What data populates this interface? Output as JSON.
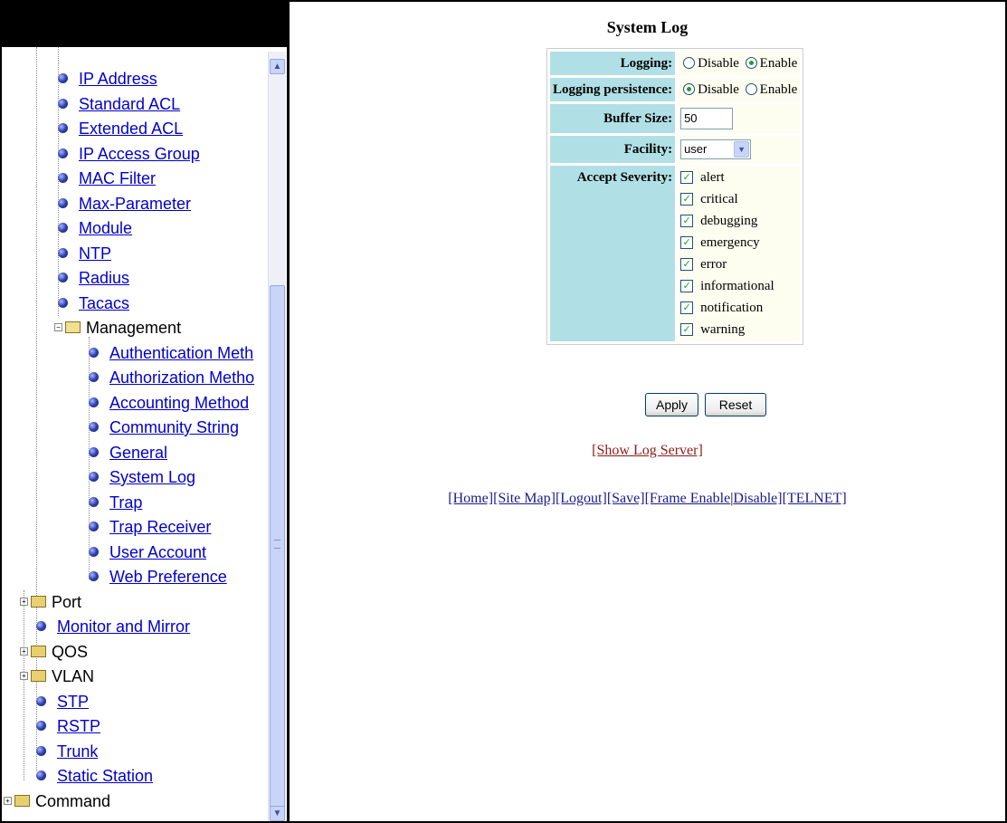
{
  "nav": {
    "items": [
      {
        "label": "IP Address",
        "link": true
      },
      {
        "label": "Standard ACL",
        "link": true
      },
      {
        "label": "Extended ACL",
        "link": true
      },
      {
        "label": "IP Access Group",
        "link": true
      },
      {
        "label": "MAC Filter",
        "link": true
      },
      {
        "label": "Max-Parameter",
        "link": true
      },
      {
        "label": "Module",
        "link": true
      },
      {
        "label": "NTP",
        "link": true
      },
      {
        "label": "Radius",
        "link": true
      },
      {
        "label": "Tacacs",
        "link": true
      },
      {
        "label": "Management",
        "link": false,
        "folder": "expanded"
      },
      {
        "label": "Authentication Meth",
        "link": true
      },
      {
        "label": "Authorization Metho",
        "link": true
      },
      {
        "label": "Accounting Method",
        "link": true
      },
      {
        "label": "Community String",
        "link": true
      },
      {
        "label": "General",
        "link": true
      },
      {
        "label": "System Log",
        "link": true
      },
      {
        "label": "Trap",
        "link": true
      },
      {
        "label": "Trap Receiver",
        "link": true
      },
      {
        "label": "User Account",
        "link": true
      },
      {
        "label": "Web Preference",
        "link": true
      },
      {
        "label": "Port",
        "link": false,
        "folder": "collapsed"
      },
      {
        "label": "Monitor and Mirror",
        "link": true
      },
      {
        "label": "QOS",
        "link": false,
        "folder": "collapsed"
      },
      {
        "label": "VLAN",
        "link": false,
        "folder": "collapsed"
      },
      {
        "label": "STP",
        "link": true
      },
      {
        "label": "RSTP",
        "link": true
      },
      {
        "label": "Trunk",
        "link": true
      },
      {
        "label": "Static Station",
        "link": true
      },
      {
        "label": "Command",
        "link": false,
        "folder": "collapsed"
      }
    ]
  },
  "main": {
    "title": "System Log",
    "logging": {
      "label": "Logging:",
      "options": [
        "Disable",
        "Enable"
      ],
      "selected": "Enable"
    },
    "persistence": {
      "label": "Logging persistence:",
      "options": [
        "Disable",
        "Enable"
      ],
      "selected": "Disable"
    },
    "buffer": {
      "label": "Buffer Size:",
      "value": "50"
    },
    "facility": {
      "label": "Facility:",
      "value": "user"
    },
    "severity": {
      "label": "Accept Severity:",
      "options": [
        "alert",
        "critical",
        "debugging",
        "emergency",
        "error",
        "informational",
        "notification",
        "warning"
      ],
      "checked": [
        true,
        true,
        true,
        true,
        true,
        true,
        true,
        true
      ]
    },
    "buttons": {
      "apply": "Apply",
      "reset": "Reset"
    },
    "show_log_server": "[Show Log Server]",
    "footer": {
      "home": "[Home]",
      "site_map": "[Site Map]",
      "logout": "[Logout]",
      "save": "[Save]",
      "frame_enable": "[Frame Enable",
      "separator": "|",
      "disable": "Disable]",
      "telnet": "[TELNET]"
    }
  },
  "colors": {
    "label_bg": "#b0e0e6",
    "value_bg": "#fdfdf0",
    "link_color": "#00c",
    "show_log_color": "#8b1a1a"
  }
}
